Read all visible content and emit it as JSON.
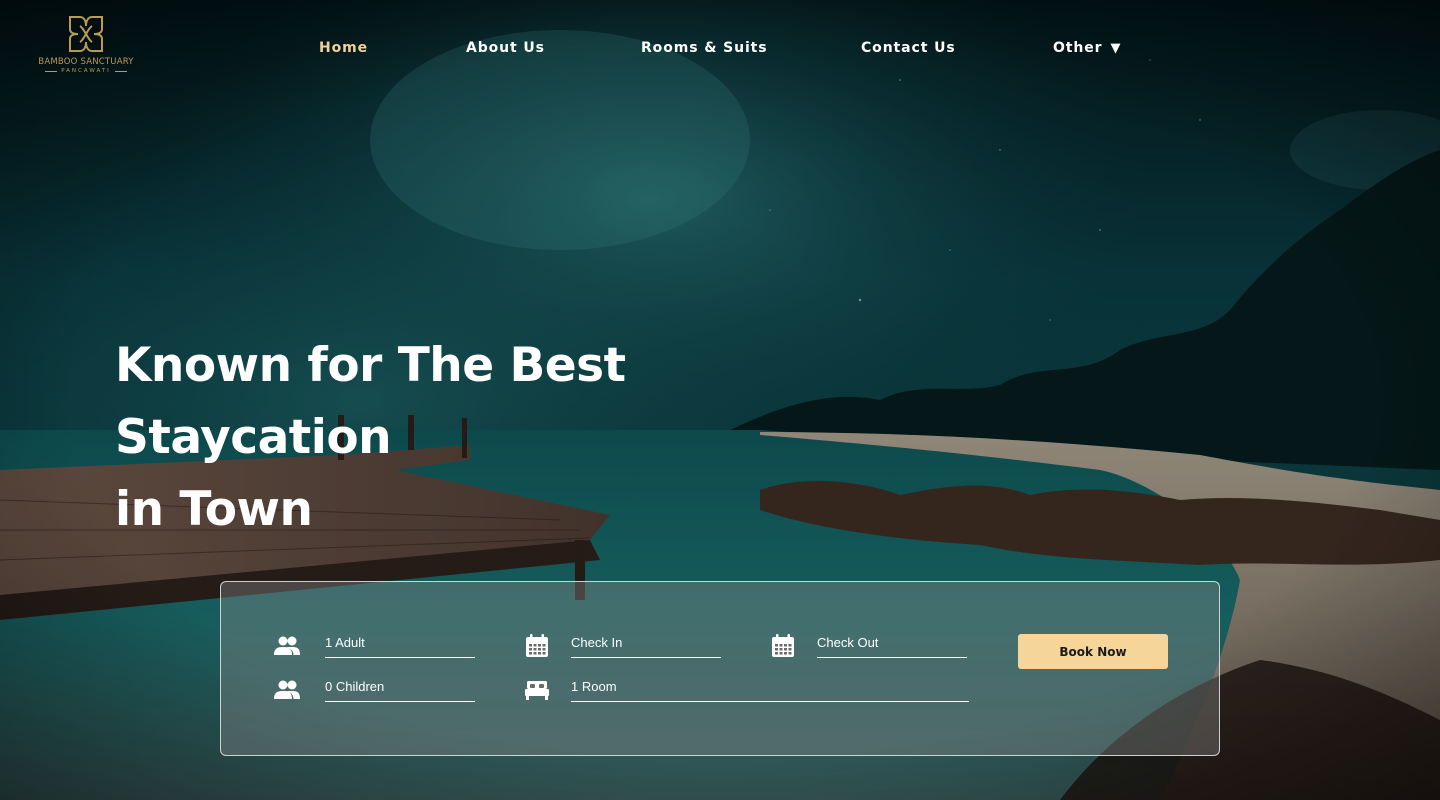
{
  "brand": {
    "name": "BAMBOO SANCTUARY",
    "subtitle": "PANCAWATI",
    "color": "#b99a57"
  },
  "nav": {
    "items": [
      {
        "label": "Home",
        "active": true
      },
      {
        "label": "About Us",
        "active": false
      },
      {
        "label": "Rooms & Suits",
        "active": false
      },
      {
        "label": "Contact Us",
        "active": false
      },
      {
        "label": "Other",
        "active": false
      }
    ],
    "other_caret": "▼",
    "active_color": "#f2d296"
  },
  "hero": {
    "title_line1": "Known for The Best Staycation",
    "title_line2": "in Town"
  },
  "booking": {
    "adults": {
      "value": "1 Adult",
      "icon": "people-icon"
    },
    "children": {
      "value": "0 Children",
      "icon": "people-icon"
    },
    "check_in": {
      "value": "Check In",
      "icon": "calendar-icon"
    },
    "rooms": {
      "value": "1 Room",
      "icon": "bed-icon"
    },
    "check_out": {
      "value": "Check Out",
      "icon": "calendar-icon"
    },
    "submit_label": "Book Now",
    "button_color": "#f5d59a"
  }
}
